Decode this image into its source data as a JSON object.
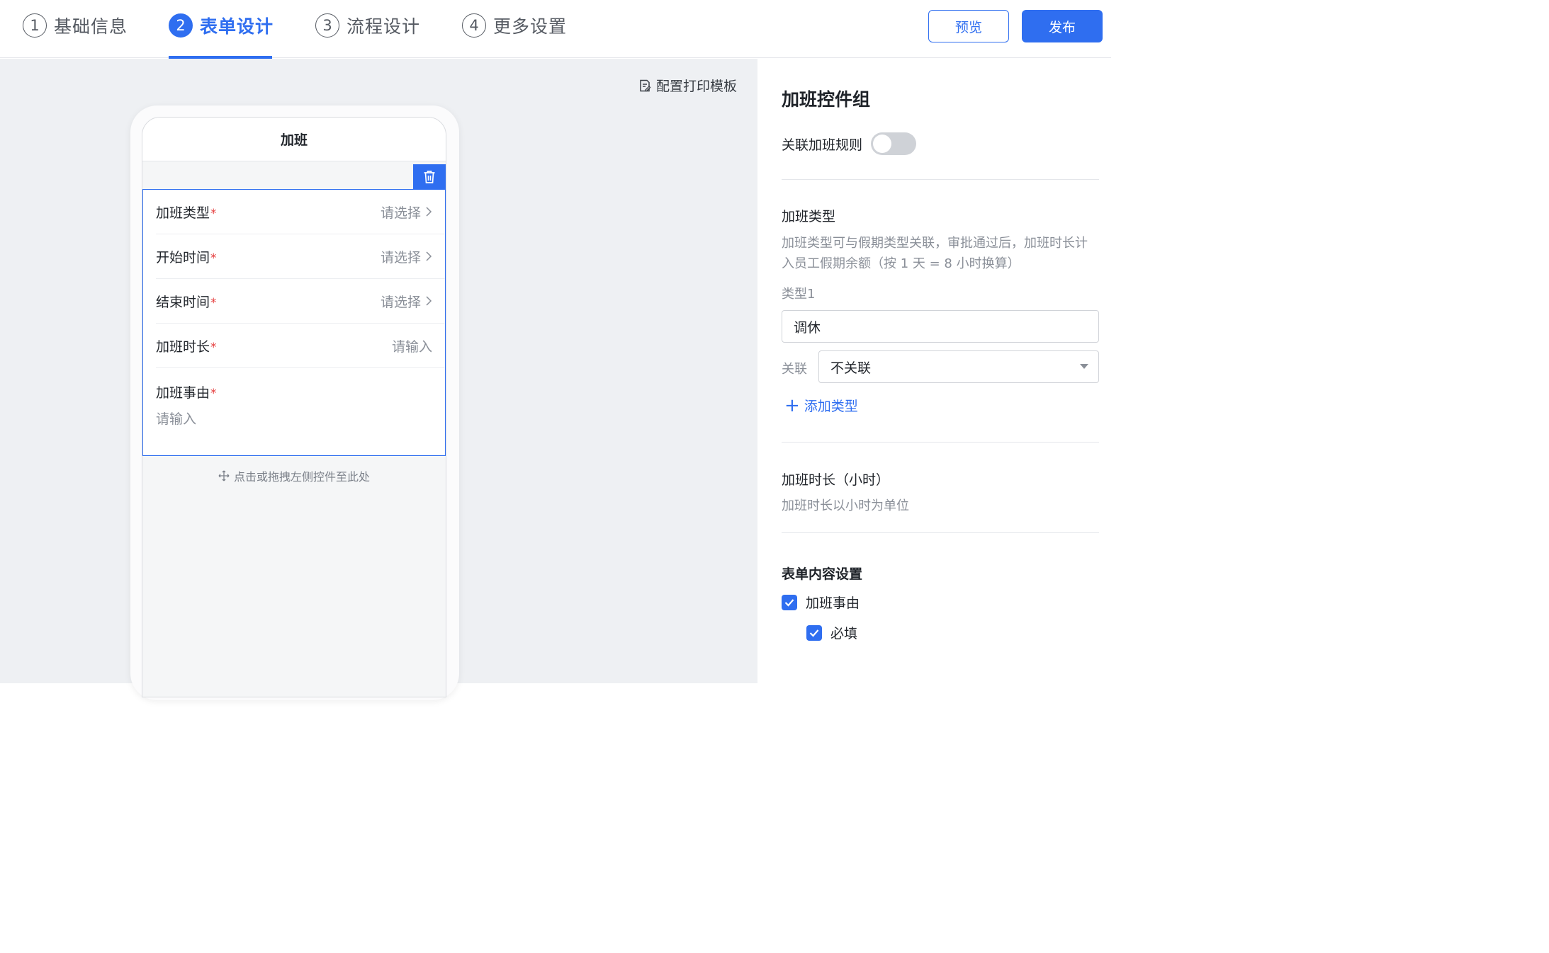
{
  "steps": [
    {
      "num": "1",
      "label": "基础信息"
    },
    {
      "num": "2",
      "label": "表单设计"
    },
    {
      "num": "3",
      "label": "流程设计"
    },
    {
      "num": "4",
      "label": "更多设置"
    }
  ],
  "actions": {
    "preview": "预览",
    "publish": "发布"
  },
  "canvas": {
    "print_template": "配置打印模板",
    "phone_title": "加班",
    "fields": [
      {
        "label": "加班类型",
        "placeholder": "请选择"
      },
      {
        "label": "开始时间",
        "placeholder": "请选择"
      },
      {
        "label": "结束时间",
        "placeholder": "请选择"
      },
      {
        "label": "加班时长",
        "placeholder": "请输入"
      },
      {
        "label": "加班事由",
        "placeholder": "请输入"
      }
    ],
    "required_mark": "*",
    "drop_hint": "点击或拖拽左侧控件至此处"
  },
  "panel": {
    "title": "加班控件组",
    "link_rule_label": "关联加班规则",
    "link_rule_enabled": false,
    "type_section_title": "加班类型",
    "type_section_desc": "加班类型可与假期类型关联，审批通过后，加班时长计入员工假期余额（按 1 天 = 8 小时换算）",
    "type1_label": "类型1",
    "type1_value": "调休",
    "relation_label": "关联",
    "relation_value": "不关联",
    "add_type": "添加类型",
    "duration_title": "加班时长（小时）",
    "duration_desc": "加班时长以小时为单位",
    "content_settings_title": "表单内容设置",
    "checkbox_reason": "加班事由",
    "checkbox_required": "必填",
    "reason_checked": true,
    "required_checked": true
  },
  "colors": {
    "accent": "#2f6ef0",
    "required": "#e53e3e",
    "toggle_off": "#cfd2d7"
  }
}
